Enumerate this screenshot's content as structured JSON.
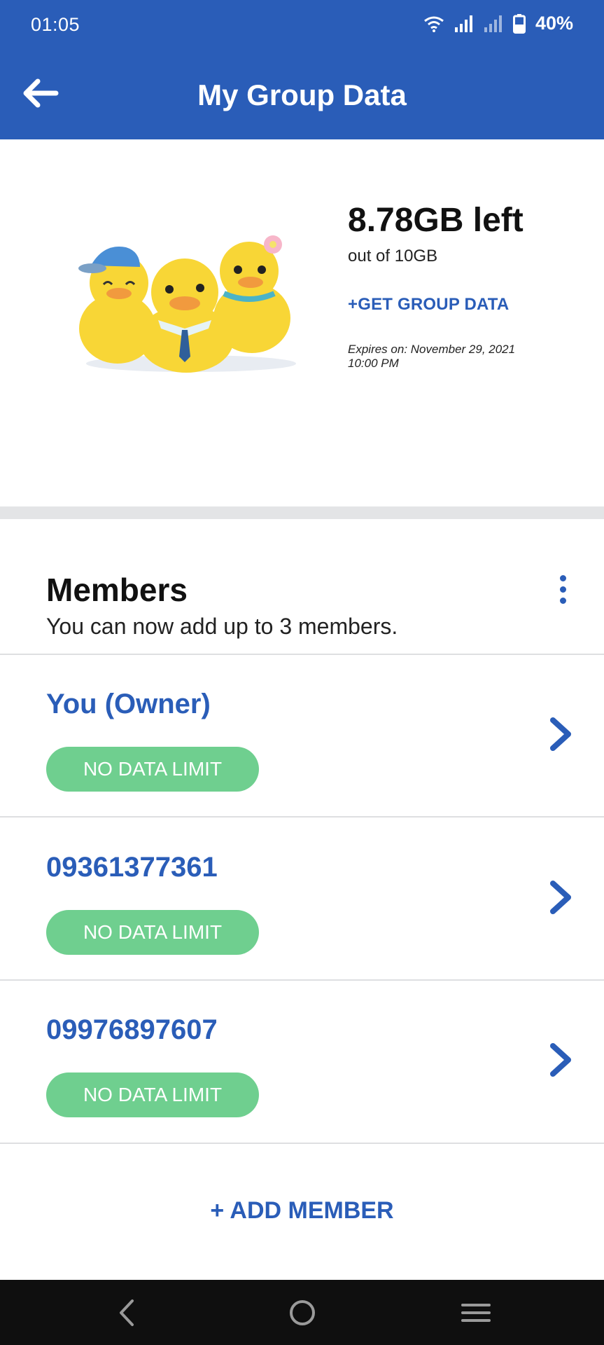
{
  "status_bar": {
    "time": "01:05",
    "battery_percent": "40%",
    "icons": [
      "wifi-icon",
      "signal-icon",
      "signal-weak-icon",
      "battery-icon"
    ]
  },
  "header": {
    "title": "My Group Data",
    "back_icon": "arrow-left-icon"
  },
  "summary": {
    "data_left": "8.78GB left",
    "out_of": "out of 10GB",
    "get_data_label": "+GET GROUP DATA",
    "expires": "Expires on: November 29, 2021 10:00 PM",
    "illustration": "three-ducks-illustration"
  },
  "members": {
    "title": "Members",
    "subtitle": "You can now add up to 3 members.",
    "list": [
      {
        "name": "You (Owner)",
        "badge": "NO DATA LIMIT"
      },
      {
        "name": "09361377361",
        "badge": "NO DATA LIMIT"
      },
      {
        "name": "09976897607",
        "badge": "NO DATA LIMIT"
      }
    ],
    "add_member_label": "+ ADD MEMBER"
  },
  "nav_bar": {
    "buttons": [
      "nav-back-icon",
      "nav-home-icon",
      "nav-recents-icon"
    ]
  },
  "colors": {
    "primary": "#2a5db8",
    "badge": "#6fcf8f",
    "navbar": "#0f0f0f"
  }
}
